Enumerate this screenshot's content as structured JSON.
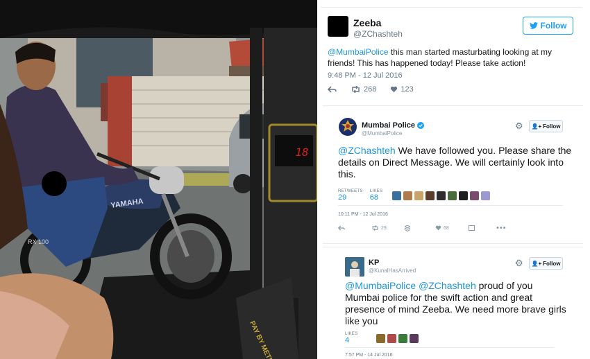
{
  "tweet_main": {
    "name": "Zeeba",
    "handle": "@ZChashteh",
    "follow_label": "Follow",
    "mention": "@MumbaiPolice",
    "text_body": " this man started masturbating looking at my friends! This has happened today! Please take action!",
    "time": "9:48 PM - 12 Jul 2016",
    "retweets": "268",
    "likes": "123"
  },
  "reply_police": {
    "name": "Mumbai Police",
    "handle": "@MumbaiPolice",
    "follow_label": "Follow",
    "mention": "@ZChashteh",
    "text_body": " We have followed you. Please share the details on Direct Message. We will certainly look into this.",
    "retweets_label": "RETWEETS",
    "retweets_count": "29",
    "likes_label": "LIKES",
    "likes_count": "68",
    "time": "10:11 PM - 12 Jul 2016",
    "action_retweets": "29",
    "action_likes": "68",
    "liker_colors": [
      "#3b6fa0",
      "#b07a4a",
      "#c9a46a",
      "#5a3d2b",
      "#2e2e2e",
      "#4a6b3a",
      "#1e1e1e",
      "#7a4b6a",
      "#9a9ad0"
    ]
  },
  "reply_kp": {
    "name": "KP",
    "handle": "@KunalHasArrived",
    "follow_label": "Follow",
    "mention1": "@MumbaiPolice",
    "mention2": "@ZChashteh",
    "text_body": " proud of you Mumbai police for the swift action and great presence of mind Zeeba. We need more brave girls like you",
    "likes_label": "LIKES",
    "likes_count": "4",
    "time": "7:57 PM - 14 Jul 2016",
    "liker_colors": [
      "#8a6a2a",
      "#b04a4a",
      "#3a7a3a",
      "#5a3a5a"
    ]
  },
  "photo": {
    "bike_brand": "YAMAHA",
    "bike_model": "RX 100",
    "meter_text": "PAY BY METER",
    "display_digits": "18"
  }
}
